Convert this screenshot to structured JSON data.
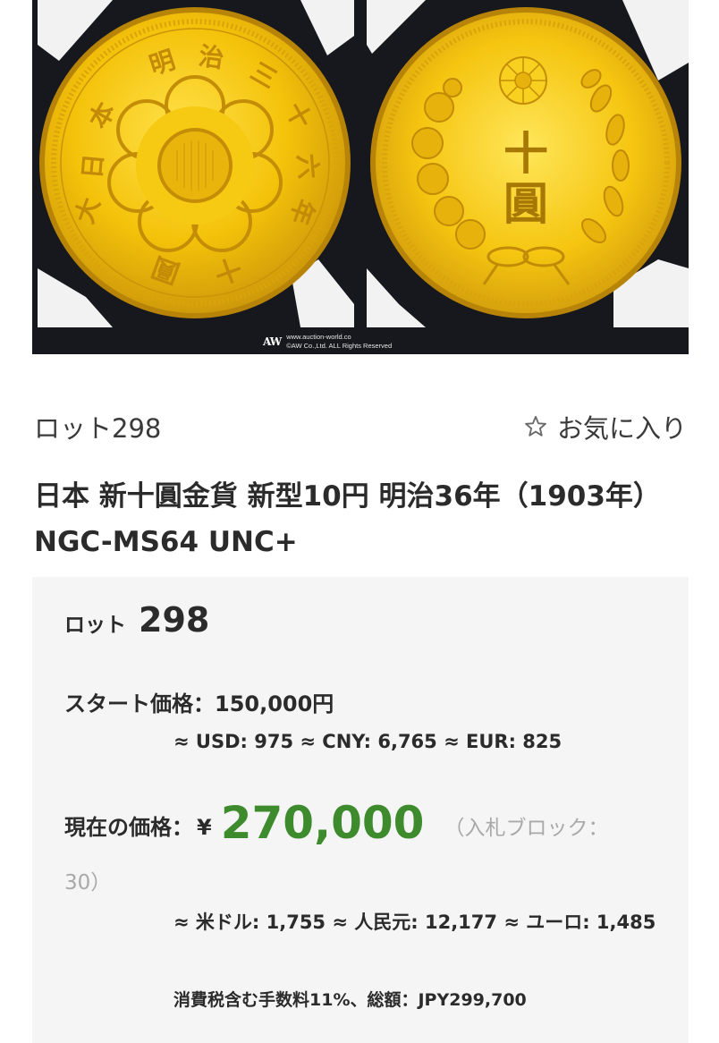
{
  "image": {
    "watermark_logo": "AW",
    "watermark_url": "www.auction-world.co",
    "watermark_copyright": "©AW Co.,Ltd. ALL Rights Reserved",
    "obverse_chars": [
      "大",
      "日",
      "本",
      "明",
      "治",
      "三",
      "十",
      "六",
      "年",
      "十",
      "圓"
    ],
    "reverse_chars": [
      "十",
      "圓"
    ],
    "colors": {
      "gold": "#f4c20a",
      "background": "#16181d",
      "holder": "#f2f2f2"
    }
  },
  "lot": {
    "label": "ロット298",
    "favorite_label": "お気に入り",
    "favorite_icon": "star-outline-icon"
  },
  "title": "日本 新十圓金貨 新型10円 明治36年（1903年） NGC-MS64 UNC+",
  "panel": {
    "lot_label": "ロット",
    "lot_number": "298",
    "start_price": "スタート価格：150,000円",
    "start_conversion": "≈ USD: 975 ≈ CNY: 6,765 ≈ EUR: 825",
    "current_label": "現在の価格：",
    "current_currency": "¥",
    "current_amount": "270,000",
    "bid_block_part1": "（入札ブロック：",
    "bid_block_part2": "30）",
    "current_conversion": "≈ 米ドル: 1,755 ≈ 人民元: 12,177 ≈ ユーロ: 1,485",
    "fee_note": "消費税含む手数料11%、総額：JPY299,700",
    "colors": {
      "price_green": "#3e8b2e",
      "panel_bg": "#f5f5f5"
    }
  }
}
